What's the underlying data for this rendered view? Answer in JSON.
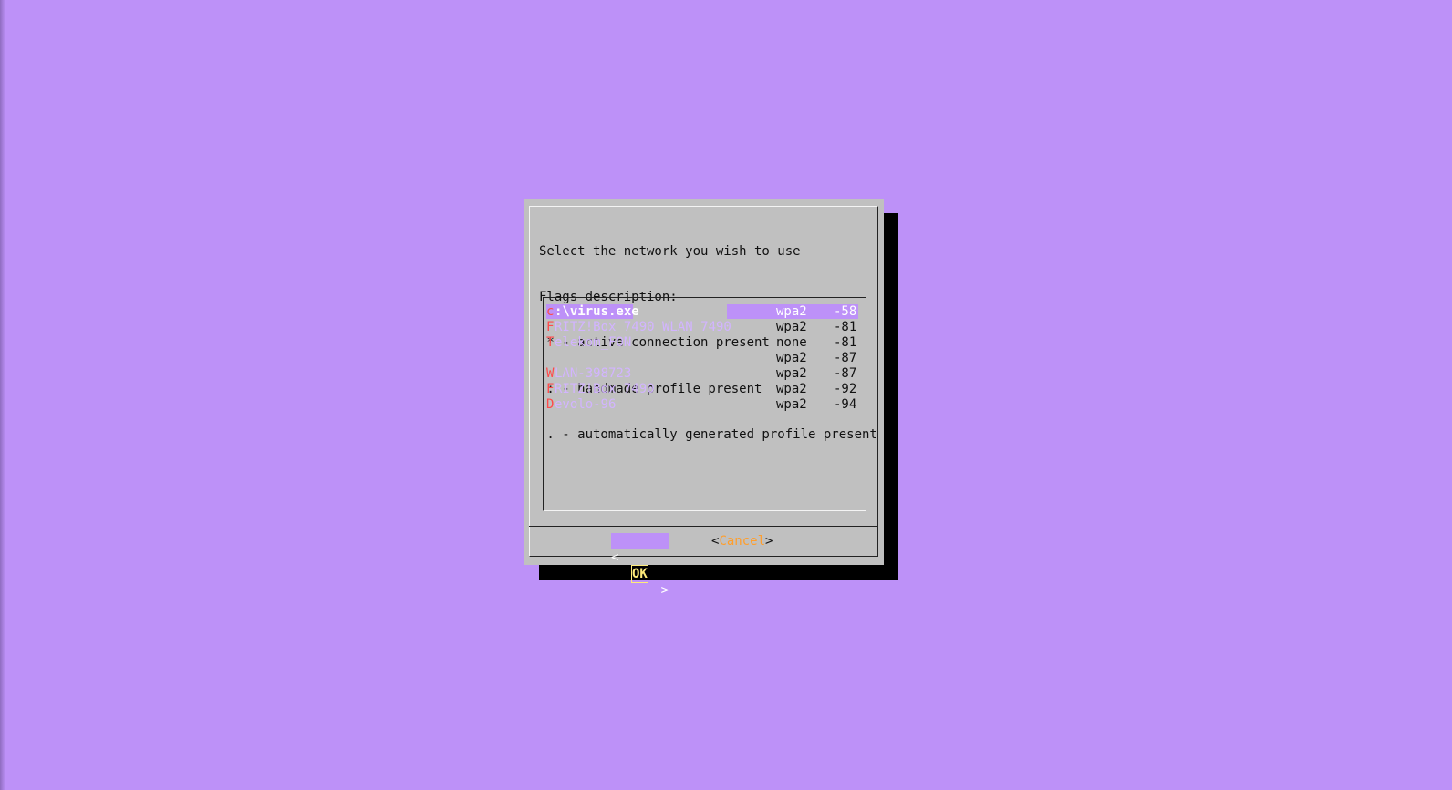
{
  "prompt": {
    "line1": "Select the network you wish to use",
    "line2": "Flags description:",
    "line3": " * - active connection present",
    "line4": " : - handmade profile present",
    "line5": " . - automatically generated profile present"
  },
  "networks": [
    {
      "flag": "c",
      "ssid": ":\\virus.exe",
      "security": "wpa2",
      "signal": "-58",
      "selected": true
    },
    {
      "flag": "F",
      "ssid": "RITZ!Box 7490 WLAN 7490",
      "security": "wpa2",
      "signal": "-81",
      "selected": false
    },
    {
      "flag": "T",
      "ssid": "elekom_FON",
      "security": "none",
      "signal": "-81",
      "selected": false
    },
    {
      "flag": "",
      "ssid": "",
      "security": "wpa2",
      "signal": "-87",
      "selected": false
    },
    {
      "flag": "W",
      "ssid": "LAN-398723",
      "security": "wpa2",
      "signal": "-87",
      "selected": false
    },
    {
      "flag": "F",
      "ssid": "RITZ!Box 7490",
      "security": "wpa2",
      "signal": "-92",
      "selected": false
    },
    {
      "flag": "D",
      "ssid": "evolo-96",
      "security": "wpa2",
      "signal": "-94",
      "selected": false
    }
  ],
  "buttons": {
    "ok_left": "<",
    "ok_label": "OK",
    "ok_right": ">",
    "cancel_left": "<",
    "cancel_label": "Cancel",
    "cancel_right": ">"
  },
  "colors": {
    "background": "#bd91f8",
    "dialog": "#c0c0c0",
    "highlight": "#bd91f8",
    "flag": "#ff4a4a",
    "cancel_label": "#ff9e2c"
  }
}
